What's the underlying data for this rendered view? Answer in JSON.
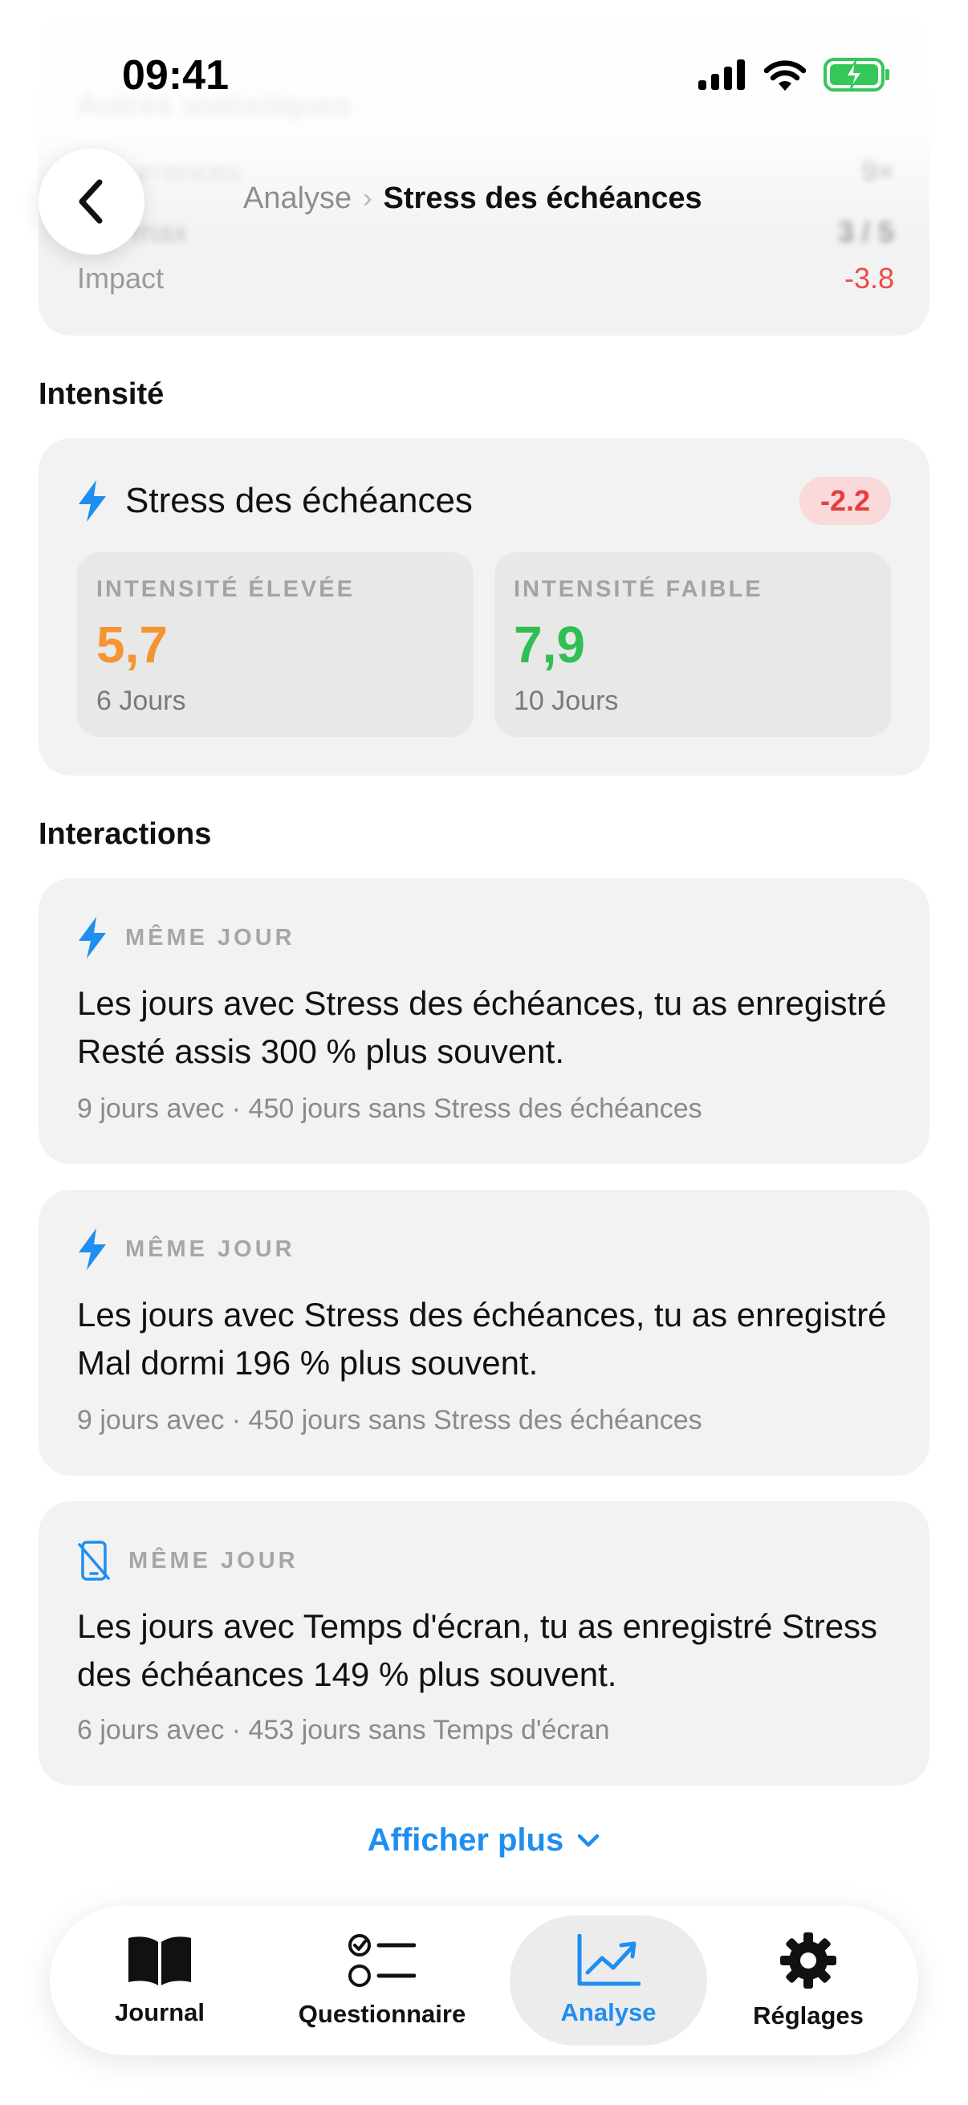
{
  "status_bar": {
    "time": "09:41"
  },
  "stats_card": {
    "title": "Autres statistiques",
    "rows": [
      {
        "label": "Occurrences",
        "value": "9×"
      },
      {
        "label": "Niv. max",
        "value": "3 / 5"
      },
      {
        "label": "Impact",
        "value": "-3.8"
      }
    ]
  },
  "header": {
    "breadcrumb_parent": "Analyse",
    "breadcrumb_separator": "›",
    "breadcrumb_current": "Stress des échéances"
  },
  "intensity": {
    "section_title": "Intensité",
    "name": "Stress des échéances",
    "badge": "-2.2",
    "high": {
      "caption": "INTENSITÉ ÉLEVÉE",
      "value": "5,7",
      "days": "6 Jours"
    },
    "low": {
      "caption": "INTENSITÉ FAIBLE",
      "value": "7,9",
      "days": "10 Jours"
    }
  },
  "interactions": {
    "section_title": "Interactions",
    "items": [
      {
        "icon": "bolt-icon",
        "tag": "MÊME JOUR",
        "text": "Les jours avec Stress des échéances, tu as enregistré Resté assis 300 % plus souvent.",
        "meta": "9 jours avec · 450 jours sans Stress des échéances"
      },
      {
        "icon": "bolt-icon",
        "tag": "MÊME JOUR",
        "text": "Les jours avec Stress des échéances, tu as enregistré Mal dormi 196 % plus souvent.",
        "meta": "9 jours avec · 450 jours sans Stress des échéances"
      },
      {
        "icon": "phone-slash-icon",
        "tag": "MÊME JOUR",
        "text": "Les jours avec Temps d'écran, tu as enregistré Stress des échéances 149 % plus souvent.",
        "meta": "6 jours avec · 453 jours sans Temps d'écran"
      }
    ],
    "show_more": "Afficher plus"
  },
  "tab_bar": {
    "active": "Analyse",
    "tabs": [
      {
        "label": "Journal",
        "icon": "book-icon"
      },
      {
        "label": "Questionnaire",
        "icon": "checklist-icon"
      },
      {
        "label": "Analyse",
        "icon": "chart-icon"
      },
      {
        "label": "Réglages",
        "icon": "gear-icon"
      }
    ]
  },
  "colors": {
    "accent": "#1f8ef1",
    "negative": "#ea3b3b",
    "high_intensity": "#f59432",
    "low_intensity": "#2fbf52",
    "card_bg": "#f2f2f2"
  }
}
